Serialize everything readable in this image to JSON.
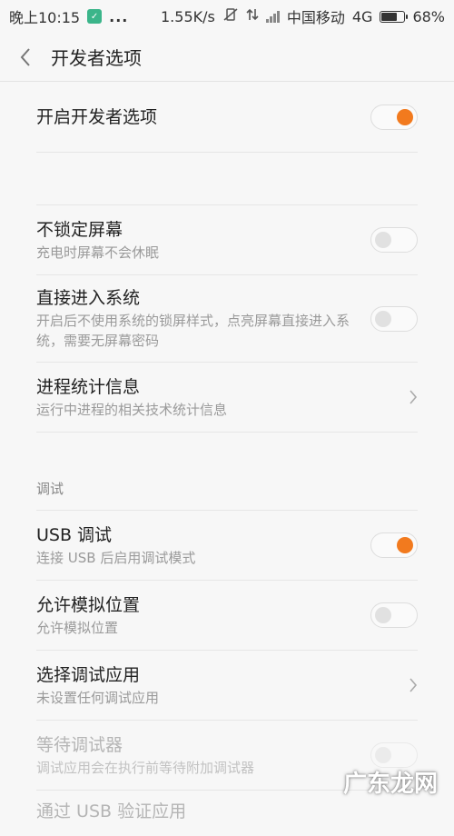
{
  "status_bar": {
    "time": "晚上10:15",
    "dots": "...",
    "speed": "1.55K/s",
    "carrier": "中国移动",
    "network": "4G",
    "battery_percent": "68%",
    "battery_level": 0.68
  },
  "header": {
    "title": "开发者选项"
  },
  "rows": {
    "dev_options": {
      "title": "开启开发者选项",
      "on": true
    },
    "stay_awake": {
      "title": "不锁定屏幕",
      "sub": "充电时屏幕不会休眠",
      "on": false
    },
    "direct_boot": {
      "title": "直接进入系统",
      "sub": "开启后不使用系统的锁屏样式，点亮屏幕直接进入系统，需要无屏幕密码",
      "on": false
    },
    "process_stats": {
      "title": "进程统计信息",
      "sub": "运行中进程的相关技术统计信息"
    },
    "usb_debug": {
      "title": "USB 调试",
      "sub": "连接 USB 后启用调试模式",
      "on": true
    },
    "mock_location": {
      "title": "允许模拟位置",
      "sub": "允许模拟位置",
      "on": false
    },
    "debug_app": {
      "title": "选择调试应用",
      "sub": "未设置任何调试应用"
    },
    "wait_debugger": {
      "title": "等待调试器",
      "sub": "调试应用会在执行前等待附加调试器",
      "on": false
    },
    "verify_usb": {
      "title": "通过 USB 验证应用"
    }
  },
  "sections": {
    "debug": "调试"
  },
  "watermark": "广东龙网",
  "colors": {
    "accent": "#f27a1e",
    "background": "#f7f7f7"
  }
}
